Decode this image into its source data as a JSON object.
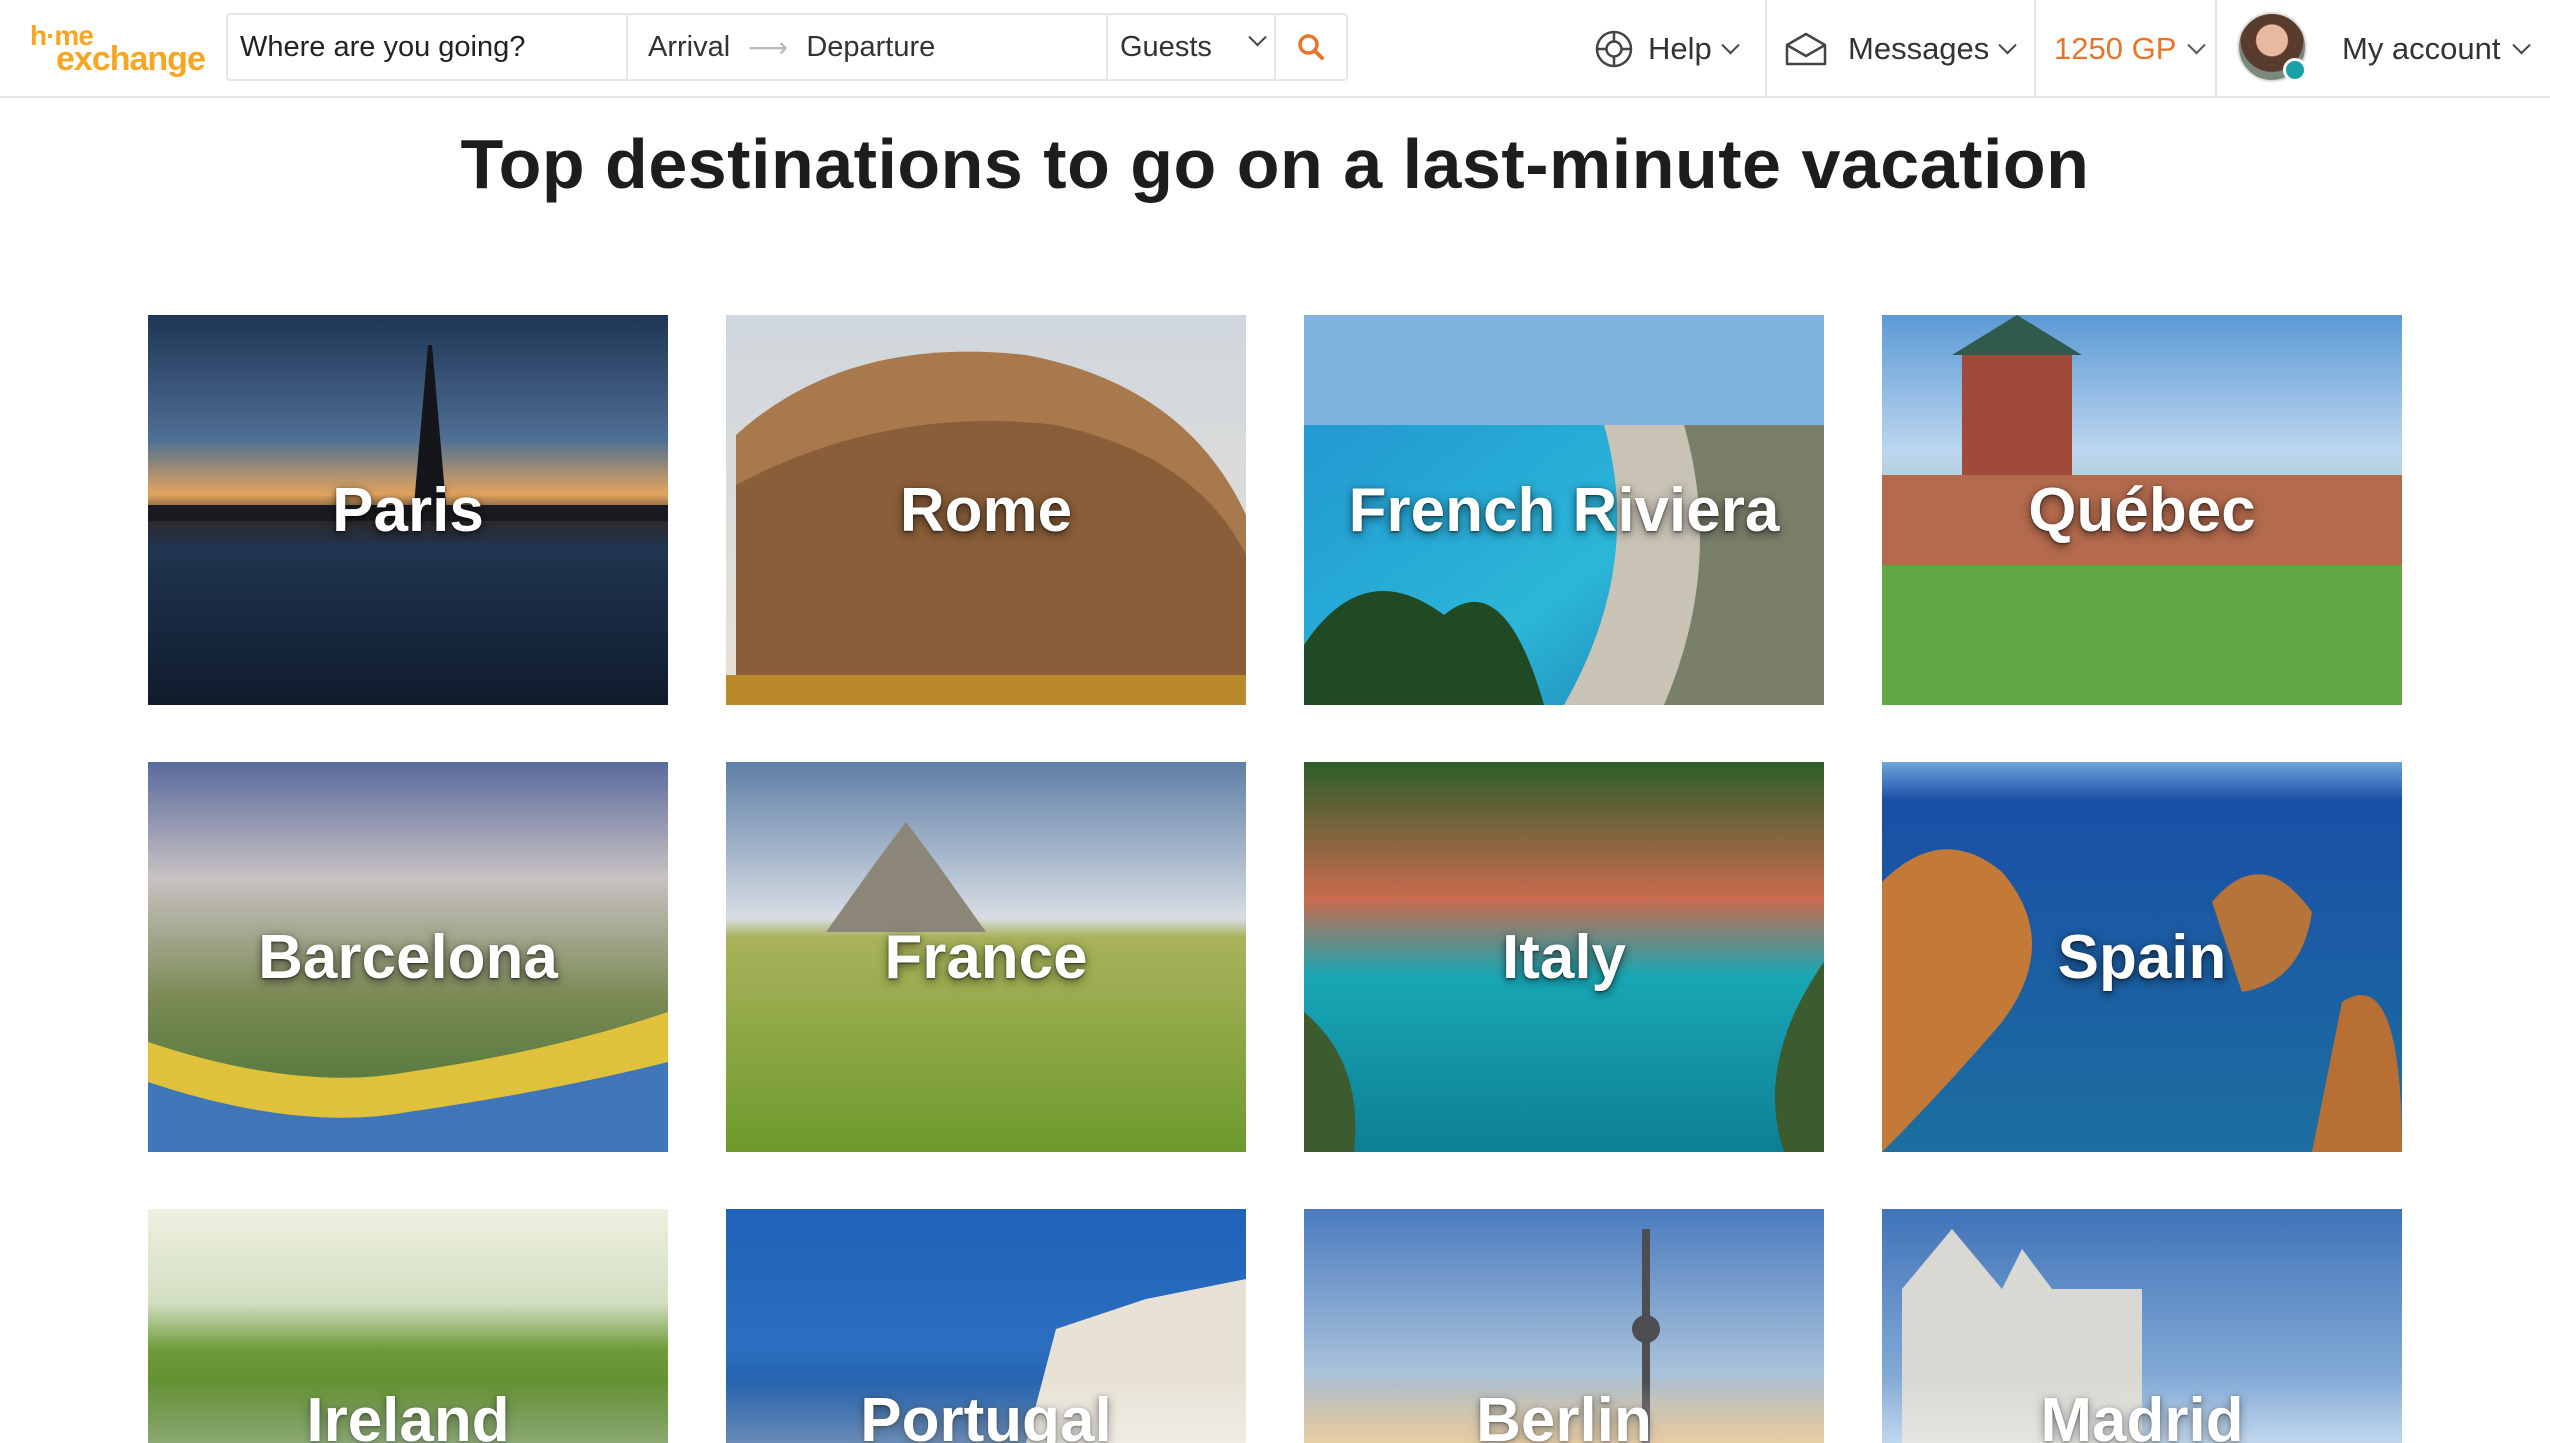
{
  "brand": {
    "logo_line1": "h·me",
    "logo_line2": "exchange",
    "accent": "#f6a623"
  },
  "search": {
    "destination_placeholder": "Where are you going?",
    "arrival": "Arrival",
    "departure": "Departure",
    "guests": "Guests",
    "search_icon": "search-icon",
    "icon_color": "#e8742a"
  },
  "nav": {
    "help": "Help",
    "messages": "Messages",
    "guest_points": "1250 GP",
    "account": "My account"
  },
  "page": {
    "title": "Top destinations to go on a last-minute vacation"
  },
  "destinations": [
    {
      "name": "Paris"
    },
    {
      "name": "Rome"
    },
    {
      "name": "French Riviera"
    },
    {
      "name": "Québec"
    },
    {
      "name": "Barcelona"
    },
    {
      "name": "France"
    },
    {
      "name": "Italy"
    },
    {
      "name": "Spain"
    },
    {
      "name": "Ireland"
    },
    {
      "name": "Portugal"
    },
    {
      "name": "Berlin"
    },
    {
      "name": "Madrid"
    }
  ]
}
